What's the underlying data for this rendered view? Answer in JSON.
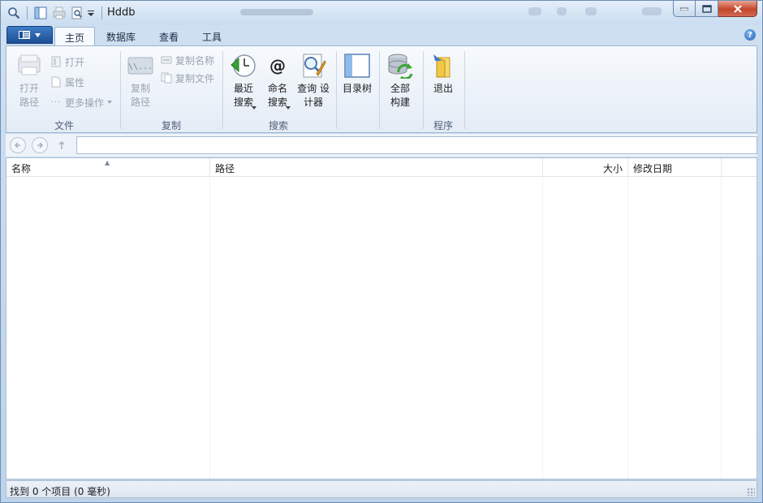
{
  "window": {
    "title": "Hddb"
  },
  "tabs": [
    {
      "label": "主页",
      "active": true
    },
    {
      "label": "数据库"
    },
    {
      "label": "查看"
    },
    {
      "label": "工具"
    }
  ],
  "ribbon": {
    "file_group": {
      "label": "文件",
      "open_path": "打开\n路径",
      "open": "打开",
      "properties": "属性",
      "more_ops": "更多操作"
    },
    "copy_group": {
      "label": "复制",
      "copy_path": "复制\n路径",
      "copy_name": "复制名称",
      "copy_file": "复制文件"
    },
    "search_group": {
      "label": "搜索",
      "recent_search": "最近\n搜索",
      "name_search": "命名\n搜索",
      "query_designer": "查询 设\n计器"
    },
    "tree_group": {
      "dir_tree": "目录树"
    },
    "build_group": {
      "full_build": "全部\n构建"
    },
    "app_group": {
      "label": "程序",
      "exit": "退出"
    }
  },
  "columns": [
    {
      "label": "名称"
    },
    {
      "label": "路径"
    },
    {
      "label": "大小"
    },
    {
      "label": "修改日期"
    }
  ],
  "status": {
    "text": "找到 0 个项目 (0 毫秒)"
  },
  "colors": {
    "accent": "#1c4f96",
    "close": "#c4452b"
  }
}
